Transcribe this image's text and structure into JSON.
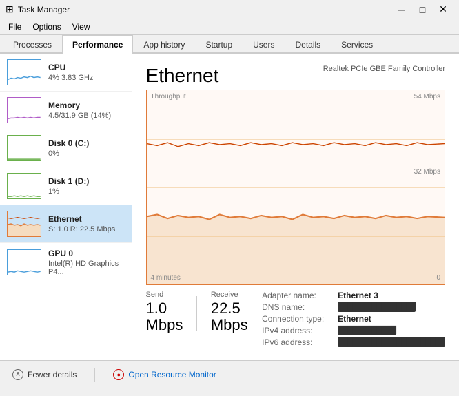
{
  "titleBar": {
    "icon": "⊞",
    "title": "Task Manager",
    "minimizeLabel": "─",
    "maximizeLabel": "□",
    "closeLabel": "✕"
  },
  "menuBar": {
    "items": [
      "File",
      "Options",
      "View"
    ]
  },
  "tabs": [
    {
      "id": "processes",
      "label": "Processes"
    },
    {
      "id": "performance",
      "label": "Performance"
    },
    {
      "id": "apphistory",
      "label": "App history"
    },
    {
      "id": "startup",
      "label": "Startup"
    },
    {
      "id": "users",
      "label": "Users"
    },
    {
      "id": "details",
      "label": "Details"
    },
    {
      "id": "services",
      "label": "Services"
    }
  ],
  "activeTab": "performance",
  "sidebar": {
    "items": [
      {
        "id": "cpu",
        "label": "CPU",
        "sub": "4% 3.83 GHz",
        "thumbColor": "#4a9edb"
      },
      {
        "id": "memory",
        "label": "Memory",
        "sub": "4.5/31.9 GB (14%)",
        "thumbColor": "#b05cc7"
      },
      {
        "id": "disk0",
        "label": "Disk 0 (C:)",
        "sub": "0%",
        "thumbColor": "#6ab04c"
      },
      {
        "id": "disk1",
        "label": "Disk 1 (D:)",
        "sub": "1%",
        "thumbColor": "#6ab04c"
      },
      {
        "id": "ethernet",
        "label": "Ethernet",
        "sub": "S: 1.0  R: 22.5 Mbps",
        "thumbColor": "#e07b39",
        "active": true
      },
      {
        "id": "gpu0",
        "label": "GPU 0",
        "sub": "Intel(R) HD Graphics P4...",
        "thumbColor": "#4a9edb"
      }
    ]
  },
  "detail": {
    "title": "Ethernet",
    "subtitle": "Realtek PCIe GBE Family Controller",
    "chartLabels": {
      "throughput": "Throughput",
      "maxMbps": "54 Mbps",
      "midMbps": "32 Mbps",
      "zero": "0",
      "timeAgo": "4 minutes"
    },
    "stats": {
      "sendLabel": "Send",
      "sendValue": "1.0 Mbps",
      "receiveLabel": "Receive",
      "receiveValue": "22.5 Mbps"
    },
    "adapter": {
      "adapterNameLabel": "Adapter name:",
      "adapterNameValue": "Ethernet 3",
      "dnsNameLabel": "DNS name:",
      "dnsNameValue": "██████████████",
      "connectionTypeLabel": "Connection type:",
      "connectionTypeValue": "Ethernet",
      "ipv4Label": "IPv4 address:",
      "ipv4Value": "████████████",
      "ipv6Label": "IPv6 address:",
      "ipv6Value": "██████████████████████"
    }
  },
  "bottomBar": {
    "fewerDetailsLabel": "Fewer details",
    "openResourceMonitorLabel": "Open Resource Monitor"
  }
}
